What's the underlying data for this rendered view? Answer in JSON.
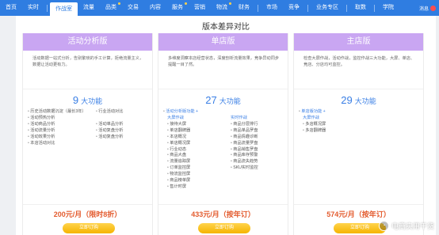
{
  "nav": {
    "items": [
      {
        "label": "首页",
        "dot": false,
        "active": false
      },
      {
        "label": "实时",
        "dot": false,
        "active": false
      },
      {
        "label": "作战室",
        "dot": false,
        "active": true
      },
      {
        "label": "流量",
        "dot": false,
        "active": false
      },
      {
        "label": "品类",
        "dot": true,
        "active": false
      },
      {
        "label": "交易",
        "dot": false,
        "active": false
      },
      {
        "label": "内容",
        "dot": false,
        "active": false
      },
      {
        "label": "服务",
        "dot": true,
        "active": false
      },
      {
        "label": "营销",
        "dot": false,
        "active": false
      },
      {
        "label": "物流",
        "dot": true,
        "active": false
      },
      {
        "label": "财务",
        "dot": false,
        "active": false
      },
      {
        "label": "市场",
        "dot": false,
        "active": false
      },
      {
        "label": "竞争",
        "dot": false,
        "active": false
      },
      {
        "label": "业务专区",
        "dot": false,
        "active": false
      },
      {
        "label": "取数",
        "dot": false,
        "active": false
      },
      {
        "label": "学院",
        "dot": false,
        "active": false
      }
    ],
    "message": "消息"
  },
  "page": {
    "title": "版本差异对比"
  },
  "cards": [
    {
      "title": "活动分析版",
      "desc": "活动数据一站式分析，告别繁琐的手工计算，拒绝流量主义，数据让活动更有力。",
      "count": "9",
      "count_unit": "大功能",
      "col1": [
        "历史活动数据沉淀（最长3年）",
        "活动预热分析",
        "活动商品分析",
        "活动流量分析",
        "活动效果分析",
        "本店活动对比"
      ],
      "col2": [
        "行业活动对比",
        "",
        "活动单品分析",
        "活动复盘分析",
        "活动复盘分析"
      ],
      "price": "200元/月（限时8折）",
      "buy": "立即订购"
    },
    {
      "title": "单店版",
      "desc": "多维度洞察本店经营状态，深度剖析流量效果，竞争异动同步提醒一目了然。",
      "count": "27",
      "count_unit": "大功能",
      "headline": "活动分析版功能",
      "subhead1": "大屏作战",
      "col1": [
        "接待大屏",
        "单店翻牌器",
        "本店概况",
        "单店概况屏",
        "行业动态",
        "商品大盘",
        "流量追踪屏",
        "订单监控屏",
        "物流监控屏",
        "商品榜单屏",
        "售计时屏"
      ],
      "subhead2": "实时作战",
      "col2": [
        "商品分层排行",
        "商品单品罗盘",
        "商品情趣诊断",
        "商品流量罗盘",
        "商品销售罗盘",
        "商品库存预警",
        "商品流失趋势",
        "SKU实时监控"
      ],
      "price": "433元/月（按年订）",
      "buy": "立即订购"
    },
    {
      "title": "主店版",
      "desc": "检查大屏作战，活动作战，监控作战三大功能，大屏、单店、竞店、分店均可监控。",
      "count": "29",
      "count_unit": "大功能",
      "headline": "单店版功能",
      "subhead1": "大屏作战",
      "col1": [
        "多店概况屏",
        "多店翻牌器"
      ],
      "price": "574元/月（按年订）",
      "buy": "立即订购"
    }
  ],
  "watermark": "电商实用干货"
}
